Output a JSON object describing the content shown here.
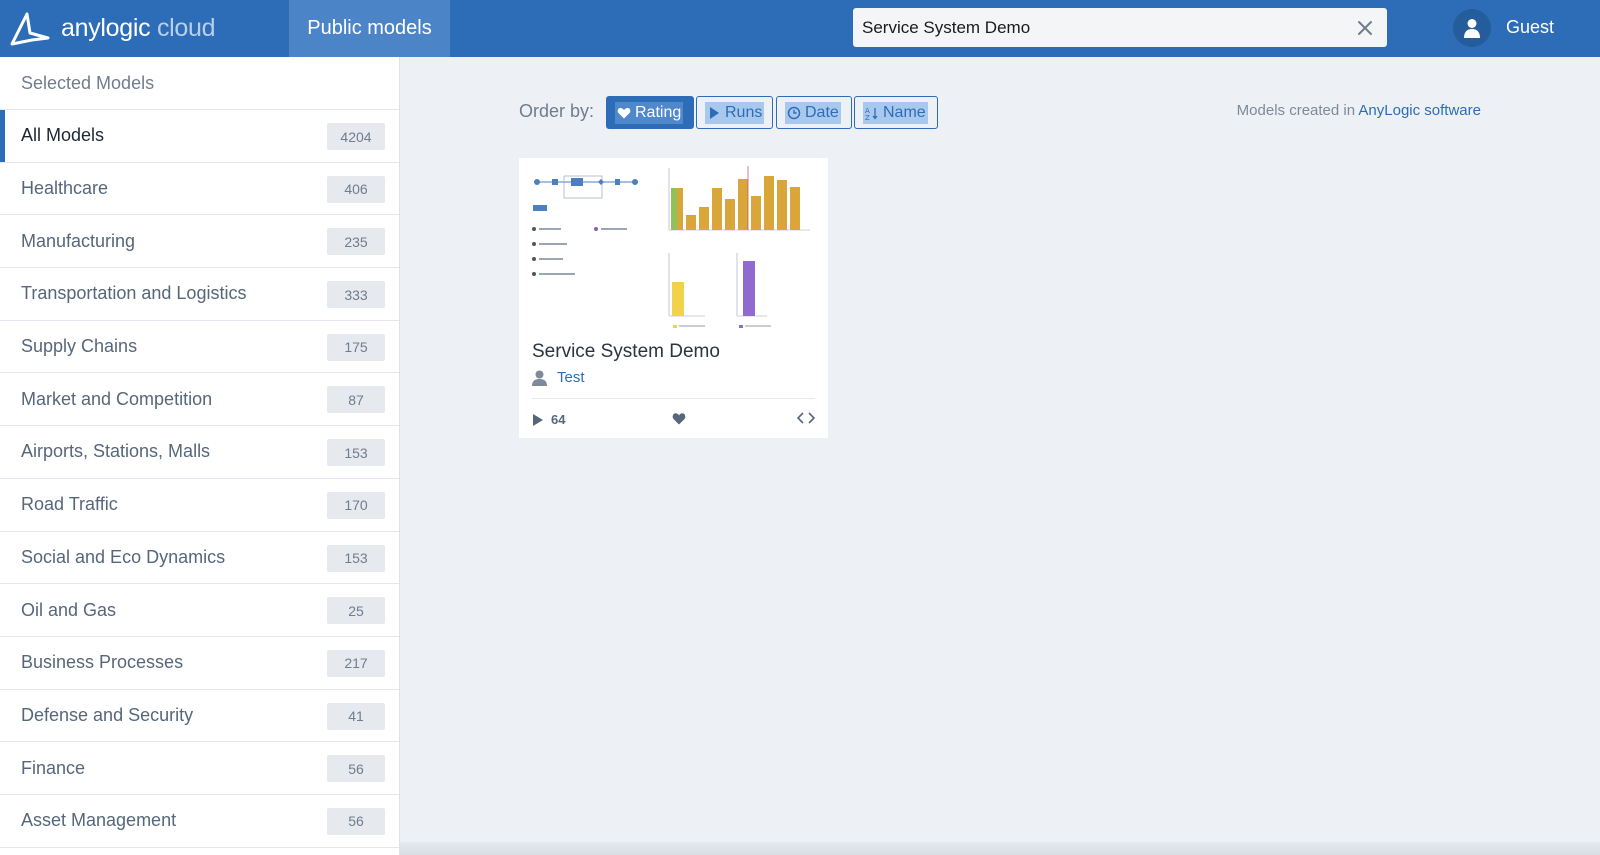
{
  "header": {
    "logo_main": "anylogic",
    "logo_sub": " cloud",
    "nav_public_models": "Public models",
    "search_value": "Service System Demo",
    "search_placeholder": "",
    "user_name": "Guest"
  },
  "sidebar": {
    "heading": "Selected Models",
    "categories": [
      {
        "label": "All Models",
        "count": "4204"
      },
      {
        "label": "Healthcare",
        "count": "406"
      },
      {
        "label": "Manufacturing",
        "count": "235"
      },
      {
        "label": "Transportation and Logistics",
        "count": "333"
      },
      {
        "label": "Supply Chains",
        "count": "175"
      },
      {
        "label": "Market and Competition",
        "count": "87"
      },
      {
        "label": "Airports, Stations, Malls",
        "count": "153"
      },
      {
        "label": "Road Traffic",
        "count": "170"
      },
      {
        "label": "Social and Eco Dynamics",
        "count": "153"
      },
      {
        "label": "Oil and Gas",
        "count": "25"
      },
      {
        "label": "Business Processes",
        "count": "217"
      },
      {
        "label": "Defense and Security",
        "count": "41"
      },
      {
        "label": "Finance",
        "count": "56"
      },
      {
        "label": "Asset Management",
        "count": "56"
      }
    ]
  },
  "main": {
    "order_label": "Order by:",
    "sort": {
      "rating": "Rating",
      "runs": "Runs",
      "date": "Date",
      "name": "Name"
    },
    "created_prefix": "Models created in ",
    "created_link": "AnyLogic software"
  },
  "card": {
    "title": "Service System Demo",
    "author": "Test",
    "runs": "64"
  },
  "colors": {
    "header_bg": "#2d6db7",
    "accent": "#2d6db7",
    "page_bg": "#edf0f5"
  }
}
